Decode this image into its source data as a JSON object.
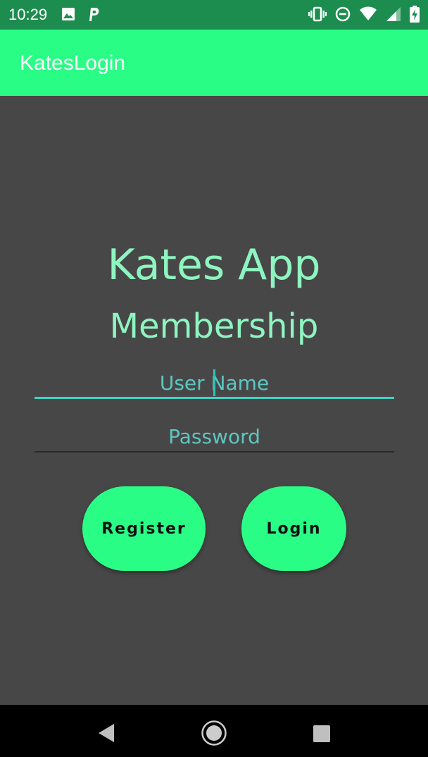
{
  "status_bar": {
    "time": "10:29",
    "left_icons": [
      "image-icon",
      "parking-icon"
    ],
    "right_icons": [
      "vibrate-icon",
      "do-not-disturb-icon",
      "wifi-icon",
      "cell-signal-icon",
      "battery-charging-icon"
    ]
  },
  "app_bar": {
    "title": "KatesLogin"
  },
  "main": {
    "heading_line1": "Kates App",
    "heading_line2": "Membership",
    "username": {
      "placeholder": "User Name",
      "value": ""
    },
    "password": {
      "placeholder": "Password",
      "value": ""
    },
    "register_label": "Register",
    "login_label": "Login"
  },
  "nav_bar": {
    "icons": [
      "back-icon",
      "home-icon",
      "recents-icon"
    ]
  },
  "colors": {
    "status_bar": "#1d8d4f",
    "app_bar": "#2afd86",
    "background": "#474747",
    "heading": "#8ef5c0",
    "field_text": "#5ec6c0",
    "focused_underline": "#40d3c4",
    "button": "#2afd86",
    "nav_bar": "#000000"
  }
}
